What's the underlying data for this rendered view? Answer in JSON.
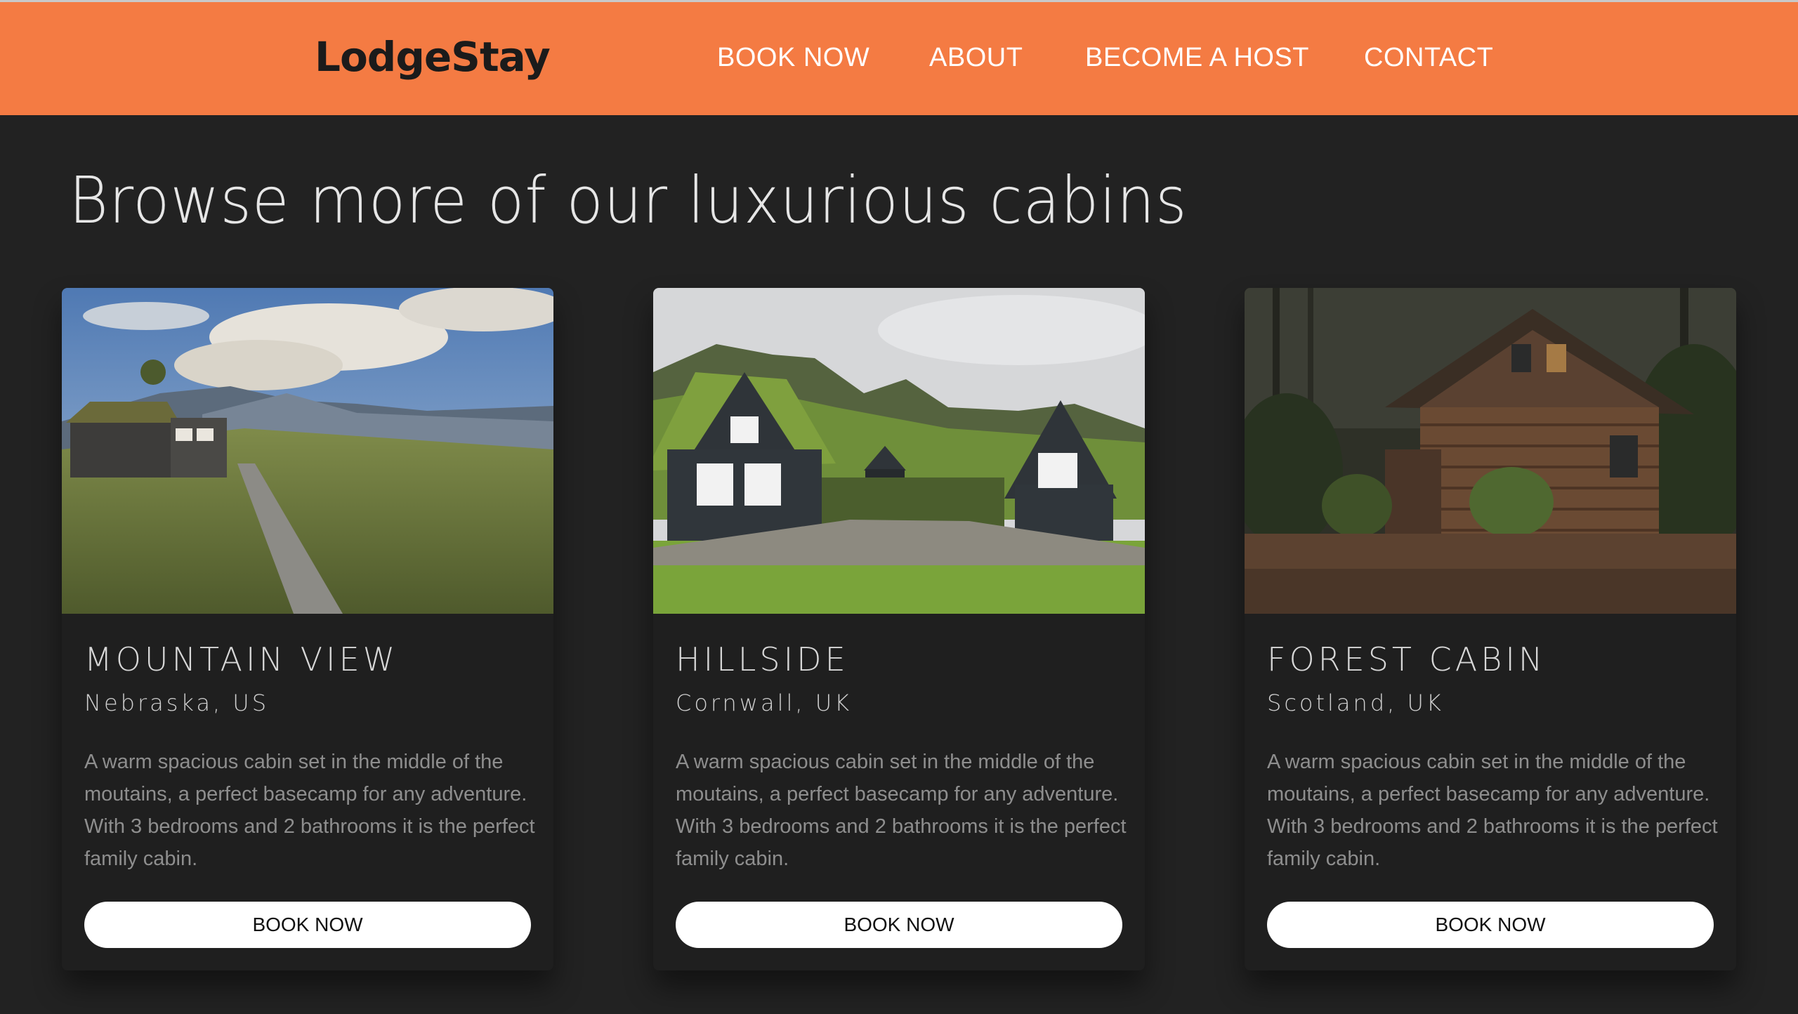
{
  "header": {
    "logo": "LodgeStay",
    "nav": [
      "BOOK NOW",
      "ABOUT",
      "BECOME A HOST",
      "CONTACT"
    ],
    "background_color": "#f47b43"
  },
  "main": {
    "title": "Browse more of our luxurious cabins",
    "cards": [
      {
        "title": "MOUNTAIN VIEW",
        "location": "Nebraska, US",
        "description": "A warm spacious cabin set in the middle of the moutains, a perfect basecamp for any adventure. With 3 bedrooms and 2 bathrooms it is the perfect family cabin.",
        "button": "BOOK NOW"
      },
      {
        "title": "HILLSIDE",
        "location": "Cornwall, UK",
        "description": "A warm spacious cabin set in the middle of the moutains, a perfect basecamp for any adventure. With 3 bedrooms and 2 bathrooms it is the perfect family cabin.",
        "button": "BOOK NOW"
      },
      {
        "title": "FOREST CABIN",
        "location": "Scotland, UK",
        "description": "A warm spacious cabin set in the middle of the moutains, a perfect basecamp for any adventure. With 3 bedrooms and 2 bathrooms it is the perfect family cabin.",
        "button": "BOOK NOW"
      }
    ]
  }
}
